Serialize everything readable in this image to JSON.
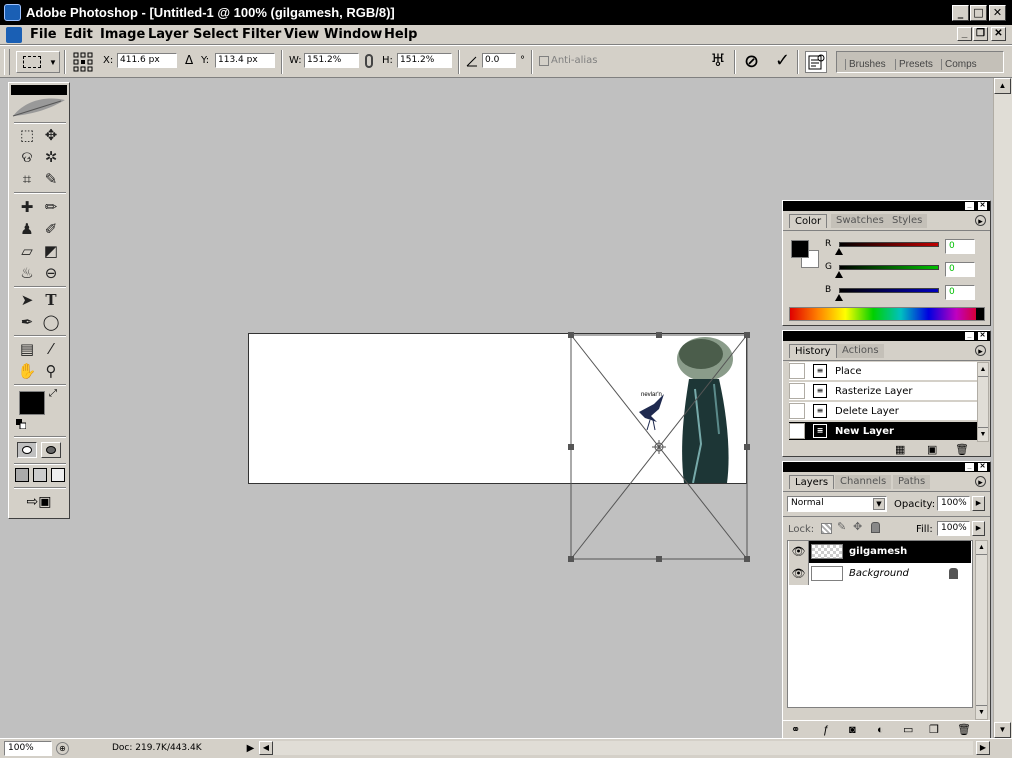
{
  "window": {
    "title": "Adobe Photoshop - [Untitled-1 @ 100% (gilgamesh, RGB/8)]"
  },
  "menu": [
    "File",
    "Edit",
    "Image",
    "Layer",
    "Select",
    "Filter",
    "View",
    "Window",
    "Help"
  ],
  "options": {
    "x_label": "X:",
    "x_value": "411.6 px",
    "delta": "Δ",
    "y_label": "Y:",
    "y_value": "113.4 px",
    "w_label": "W:",
    "w_value": "151.2%",
    "h_label": "H:",
    "h_value": "151.2%",
    "angle_value": "0.0",
    "degree": "°",
    "antialias_label": "Anti-alias",
    "cancel_symbol": "⊘",
    "commit_symbol": "✓",
    "palette_tabs": [
      "Brushes",
      "Presets",
      "Comps"
    ]
  },
  "color_panel": {
    "tabs": [
      "Color",
      "Swatches",
      "Styles"
    ],
    "channels": [
      {
        "label": "R",
        "value": "0",
        "color": "#c00000"
      },
      {
        "label": "G",
        "value": "0",
        "color": "#00c000"
      },
      {
        "label": "B",
        "value": "0",
        "color": "#0000c0"
      }
    ],
    "value_color": "#00c000"
  },
  "history_panel": {
    "tabs": [
      "History",
      "Actions"
    ],
    "items": [
      "Place",
      "Rasterize Layer",
      "Delete Layer",
      "New Layer"
    ],
    "selected": "New Layer"
  },
  "layers_panel": {
    "tabs": [
      "Layers",
      "Channels",
      "Paths"
    ],
    "blend_mode": "Normal",
    "opacity_label": "Opacity:",
    "opacity_value": "100%",
    "lock_label": "Lock:",
    "fill_label": "Fill:",
    "fill_value": "100%",
    "layers": [
      {
        "name": "gilgamesh",
        "selected": true
      },
      {
        "name": "Background",
        "selected": false
      }
    ]
  },
  "canvas": {
    "bird_caption": "nevlar'n"
  },
  "status": {
    "zoom": "100%",
    "doc": "Doc: 219.7K/443.4K"
  }
}
